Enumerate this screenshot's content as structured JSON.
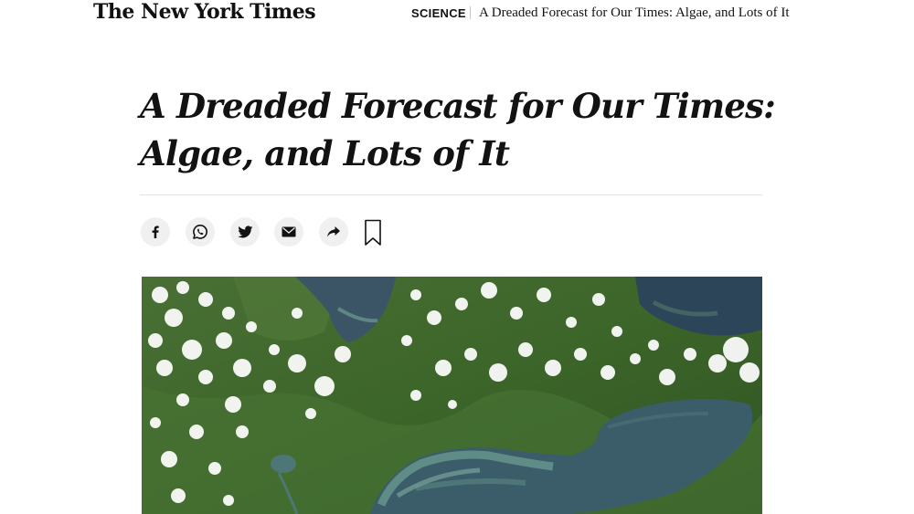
{
  "header": {
    "logo": "The New York Times",
    "section": "SCIENCE",
    "title": "A Dreaded Forecast for Our Times: Algae, and Lots of It"
  },
  "article": {
    "headline_line1": "A Dreaded Forecast for Our Times:",
    "headline_line2": "Algae, and Lots of It"
  },
  "share_tools": [
    {
      "icon": "facebook-icon"
    },
    {
      "icon": "whatsapp-icon"
    },
    {
      "icon": "twitter-icon"
    },
    {
      "icon": "email-icon"
    },
    {
      "icon": "share-arrow-icon"
    },
    {
      "icon": "bookmark-icon"
    }
  ],
  "colors": {
    "text": "#121212",
    "share_bg": "#f0f0f0",
    "rule": "#e2e2e2",
    "lake_water": "#3e5f6c",
    "algae": "#5e9a8a",
    "land": "#3f6a2c"
  }
}
